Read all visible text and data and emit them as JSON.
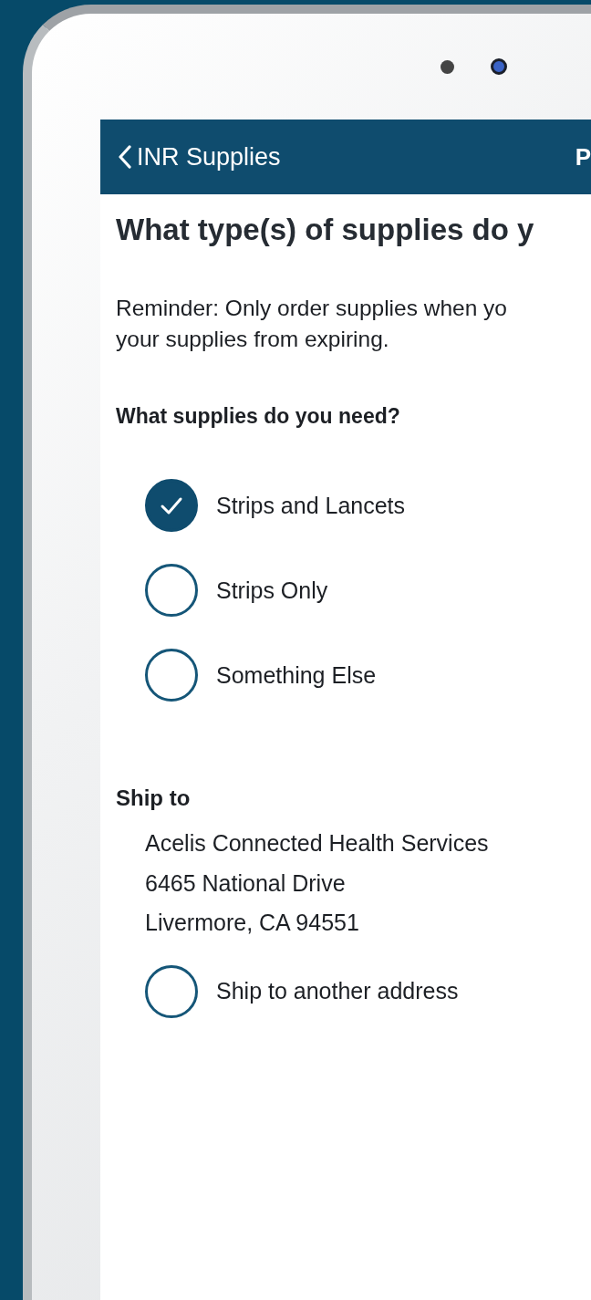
{
  "nav_bar": {
    "back_label": "INR Supplies",
    "right_label": "P"
  },
  "heading": "What type(s) of supplies do y",
  "reminder": "Reminder: Only order supplies when yo\nyour supplies from expiring.",
  "question": "What supplies do you need?",
  "options": [
    {
      "label": "Strips and Lancets",
      "selected": true
    },
    {
      "label": "Strips Only",
      "selected": false
    },
    {
      "label": "Something Else",
      "selected": false
    }
  ],
  "ship_to": {
    "title": "Ship to",
    "address_lines": [
      "Acelis Connected Health Services",
      "6465 National Drive",
      "Livermore, CA 94551"
    ],
    "other_address": {
      "label": "Ship to another address",
      "selected": false
    }
  }
}
